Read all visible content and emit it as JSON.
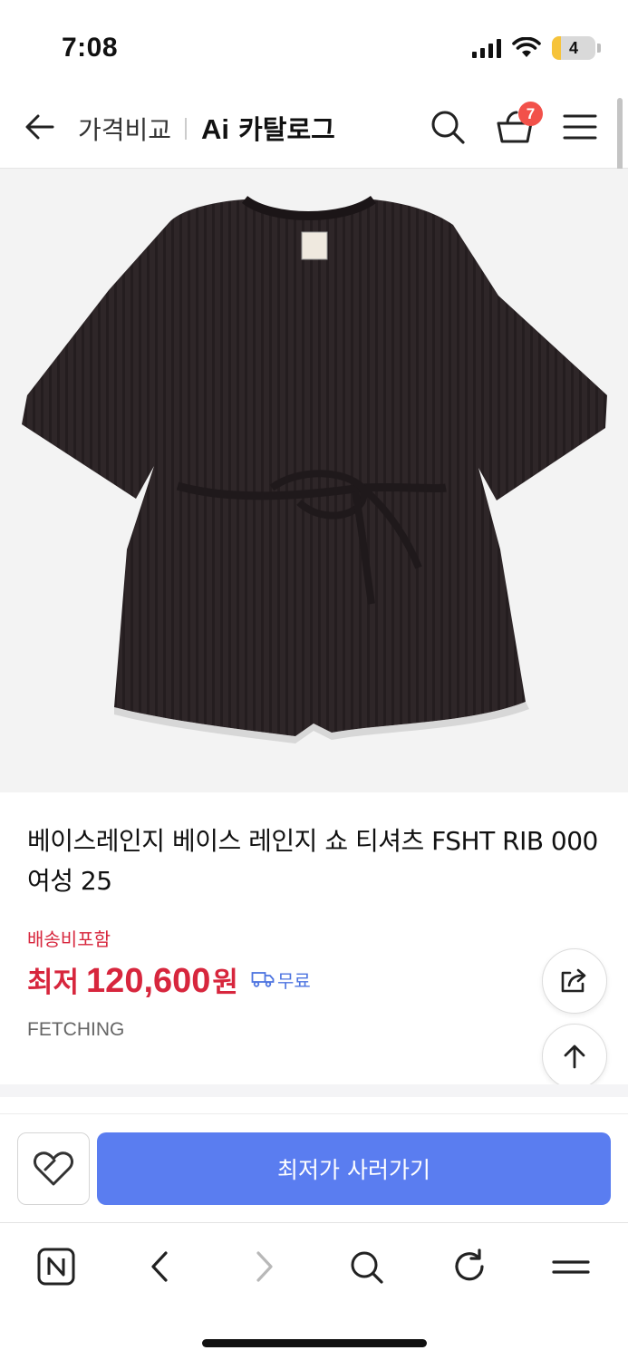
{
  "status_bar": {
    "time": "7:08",
    "battery": "4"
  },
  "header": {
    "title_compare": "가격비교",
    "title_ai": "Ai",
    "title_catalog": "카탈로그",
    "cart_count": "7"
  },
  "product": {
    "title": "베이스레인지 베이스 레인지 쇼 티셔츠 FSHT RIB 000 여성 25",
    "shipping_note": "배송비포함",
    "price_label": "최저",
    "price_value": "120,600",
    "price_unit": "원",
    "free_shipping": "무료",
    "seller": "FETCHING"
  },
  "actions": {
    "buy_label": "최저가 사러가기"
  },
  "icons": {
    "back": "back-arrow-icon",
    "search": "search-icon",
    "cart": "cart-icon",
    "menu": "menu-icon",
    "share": "share-icon",
    "scroll_top": "arrow-up-icon",
    "wish": "heart-icon",
    "truck": "truck-icon"
  },
  "colors": {
    "price_red": "#d7263d",
    "accent_blue": "#5a7df0",
    "badge_red": "#f2514a",
    "free_ship_blue": "#4d74e0"
  }
}
